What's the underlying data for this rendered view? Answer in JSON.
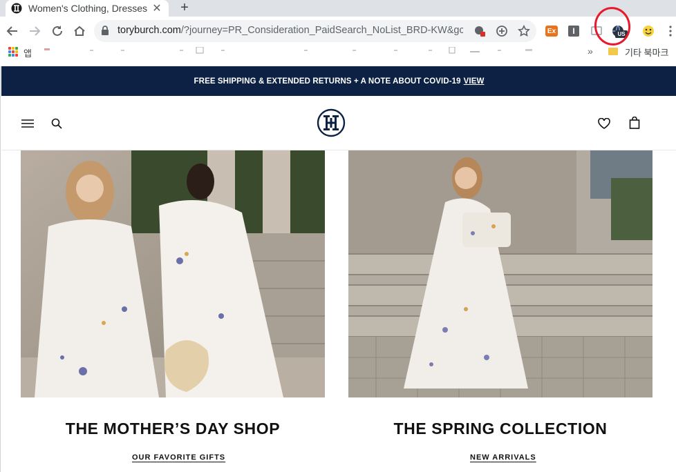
{
  "browser": {
    "tab": {
      "title": "Women's Clothing, Dresses",
      "close_glyph": "✕"
    },
    "new_tab_glyph": "+",
    "omnibox": {
      "url_host": "toryburch.com",
      "url_rest": "/?journey=PR_Consideration_PaidSearch_NoList_BRD-KW&gcli..."
    },
    "extensions": {
      "ex_label": "Ex",
      "i_label": "I",
      "vpn_badge": "US"
    },
    "bookmarks": {
      "apps_label": "앱",
      "more_glyph": "»",
      "other_bookmarks": "기타 북마크"
    },
    "colors": {
      "annotation": "#e8192c",
      "apps_grid": [
        "#ea4335",
        "#fbbc05",
        "#34a853",
        "#4285f4",
        "#ea4335",
        "#fbbc05",
        "#34a853",
        "#4285f4",
        "#ea4335"
      ]
    }
  },
  "site": {
    "promo_bar": {
      "text": "FREE SHIPPING & EXTENDED RETURNS + A NOTE ABOUT COVID-19",
      "link": "VIEW"
    },
    "header": {
      "menu_icon": "menu-icon",
      "search_icon": "search-icon",
      "logo": "tory-burch-logo",
      "wishlist_icon": "heart-icon",
      "bag_icon": "bag-icon"
    },
    "cards": [
      {
        "title": "THE MOTHER’S DAY SHOP",
        "link": "OUR FAVORITE GIFTS"
      },
      {
        "title": "THE SPRING COLLECTION",
        "link": "NEW ARRIVALS"
      }
    ],
    "colors": {
      "navy": "#0c2143"
    }
  }
}
